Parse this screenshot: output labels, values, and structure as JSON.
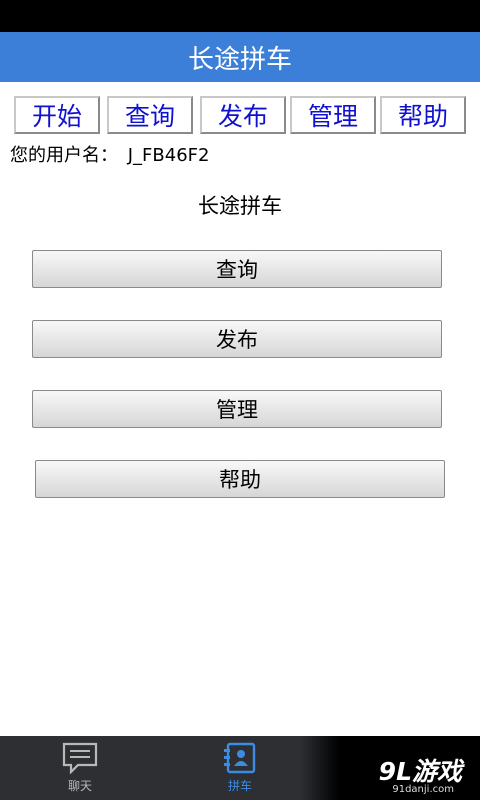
{
  "header": {
    "title": "长途拼车"
  },
  "nav": [
    {
      "label": "开始"
    },
    {
      "label": "查询"
    },
    {
      "label": "发布"
    },
    {
      "label": "管理"
    },
    {
      "label": "帮助"
    }
  ],
  "user": {
    "prefix": "您的用户名：",
    "name": "J_FB46F2"
  },
  "page": {
    "heading": "长途拼车"
  },
  "menu": [
    {
      "label": "查询"
    },
    {
      "label": "发布"
    },
    {
      "label": "管理"
    },
    {
      "label": "帮助"
    }
  ],
  "tabs": [
    {
      "label": "聊天",
      "icon": "chat-icon",
      "active": false
    },
    {
      "label": "拼车",
      "icon": "contacts-icon",
      "active": true
    }
  ],
  "watermark": {
    "logo": "9L游戏",
    "url": "91danji.com"
  },
  "colors": {
    "title_bar": "#3c7fd8",
    "nav_text": "#1010d0",
    "active_tab": "#3c8ce6",
    "inactive_tab": "#b8b8b8"
  }
}
